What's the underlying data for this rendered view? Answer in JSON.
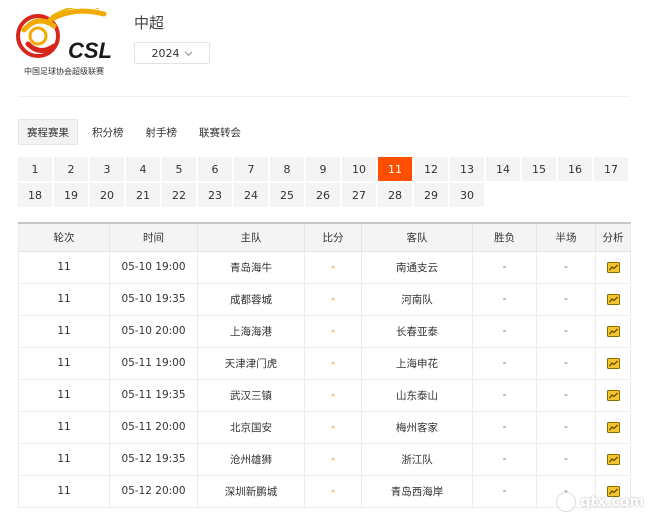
{
  "header": {
    "logo_text": "CSL",
    "logo_caption": "中国足球协会超级联赛",
    "league_title": "中超",
    "year": "2024"
  },
  "tabs": [
    {
      "label": "赛程赛果",
      "active": true
    },
    {
      "label": "积分榜",
      "active": false
    },
    {
      "label": "射手榜",
      "active": false
    },
    {
      "label": "联赛转会",
      "active": false
    }
  ],
  "rounds": {
    "row1": [
      "1",
      "2",
      "3",
      "4",
      "5",
      "6",
      "7",
      "8",
      "9",
      "10",
      "11",
      "12",
      "13",
      "14",
      "15",
      "16",
      "17"
    ],
    "row2": [
      "18",
      "19",
      "20",
      "21",
      "22",
      "23",
      "24",
      "25",
      "26",
      "27",
      "28",
      "29",
      "30"
    ],
    "active": "11"
  },
  "table": {
    "headers": [
      "轮次",
      "时间",
      "主队",
      "比分",
      "客队",
      "胜负",
      "半场",
      "分析"
    ],
    "rows": [
      {
        "round": "11",
        "time": "05-10 19:00",
        "home": "青岛海牛",
        "score": "-",
        "away": "南通支云",
        "result": "-",
        "half": "-"
      },
      {
        "round": "11",
        "time": "05-10 19:35",
        "home": "成都蓉城",
        "score": "-",
        "away": "河南队",
        "result": "-",
        "half": "-"
      },
      {
        "round": "11",
        "time": "05-10 20:00",
        "home": "上海海港",
        "score": "-",
        "away": "长春亚泰",
        "result": "-",
        "half": "-"
      },
      {
        "round": "11",
        "time": "05-11 19:00",
        "home": "天津津门虎",
        "score": "-",
        "away": "上海申花",
        "result": "-",
        "half": "-"
      },
      {
        "round": "11",
        "time": "05-11 19:35",
        "home": "武汉三镇",
        "score": "-",
        "away": "山东泰山",
        "result": "-",
        "half": "-"
      },
      {
        "round": "11",
        "time": "05-11 20:00",
        "home": "北京国安",
        "score": "-",
        "away": "梅州客家",
        "result": "-",
        "half": "-"
      },
      {
        "round": "11",
        "time": "05-12 19:35",
        "home": "沧州雄狮",
        "score": "-",
        "away": "浙江队",
        "result": "-",
        "half": "-"
      },
      {
        "round": "11",
        "time": "05-12 20:00",
        "home": "深圳新鹏城",
        "score": "-",
        "away": "青岛西海岸",
        "result": "-",
        "half": "-"
      }
    ]
  },
  "watermark": "qtx.com",
  "colors": {
    "accent": "#ff4e00",
    "score": "#ff6a00",
    "logo_red": "#d9261c",
    "logo_gold": "#f2a900"
  },
  "icons": {
    "year_dropdown": "chevron-down-icon",
    "analysis": "analysis-chart-icon"
  }
}
